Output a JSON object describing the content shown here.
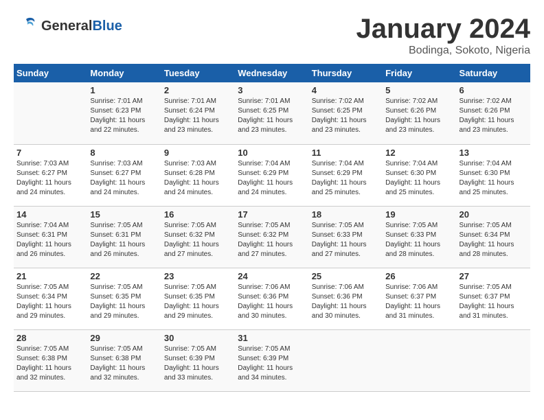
{
  "header": {
    "logo_line1": "General",
    "logo_line2": "Blue",
    "month": "January 2024",
    "location": "Bodinga, Sokoto, Nigeria"
  },
  "days_of_week": [
    "Sunday",
    "Monday",
    "Tuesday",
    "Wednesday",
    "Thursday",
    "Friday",
    "Saturday"
  ],
  "weeks": [
    [
      {
        "day": "",
        "info": ""
      },
      {
        "day": "1",
        "info": "Sunrise: 7:01 AM\nSunset: 6:23 PM\nDaylight: 11 hours\nand 22 minutes."
      },
      {
        "day": "2",
        "info": "Sunrise: 7:01 AM\nSunset: 6:24 PM\nDaylight: 11 hours\nand 23 minutes."
      },
      {
        "day": "3",
        "info": "Sunrise: 7:01 AM\nSunset: 6:25 PM\nDaylight: 11 hours\nand 23 minutes."
      },
      {
        "day": "4",
        "info": "Sunrise: 7:02 AM\nSunset: 6:25 PM\nDaylight: 11 hours\nand 23 minutes."
      },
      {
        "day": "5",
        "info": "Sunrise: 7:02 AM\nSunset: 6:26 PM\nDaylight: 11 hours\nand 23 minutes."
      },
      {
        "day": "6",
        "info": "Sunrise: 7:02 AM\nSunset: 6:26 PM\nDaylight: 11 hours\nand 23 minutes."
      }
    ],
    [
      {
        "day": "7",
        "info": "Sunrise: 7:03 AM\nSunset: 6:27 PM\nDaylight: 11 hours\nand 24 minutes."
      },
      {
        "day": "8",
        "info": "Sunrise: 7:03 AM\nSunset: 6:27 PM\nDaylight: 11 hours\nand 24 minutes."
      },
      {
        "day": "9",
        "info": "Sunrise: 7:03 AM\nSunset: 6:28 PM\nDaylight: 11 hours\nand 24 minutes."
      },
      {
        "day": "10",
        "info": "Sunrise: 7:04 AM\nSunset: 6:29 PM\nDaylight: 11 hours\nand 24 minutes."
      },
      {
        "day": "11",
        "info": "Sunrise: 7:04 AM\nSunset: 6:29 PM\nDaylight: 11 hours\nand 25 minutes."
      },
      {
        "day": "12",
        "info": "Sunrise: 7:04 AM\nSunset: 6:30 PM\nDaylight: 11 hours\nand 25 minutes."
      },
      {
        "day": "13",
        "info": "Sunrise: 7:04 AM\nSunset: 6:30 PM\nDaylight: 11 hours\nand 25 minutes."
      }
    ],
    [
      {
        "day": "14",
        "info": "Sunrise: 7:04 AM\nSunset: 6:31 PM\nDaylight: 11 hours\nand 26 minutes."
      },
      {
        "day": "15",
        "info": "Sunrise: 7:05 AM\nSunset: 6:31 PM\nDaylight: 11 hours\nand 26 minutes."
      },
      {
        "day": "16",
        "info": "Sunrise: 7:05 AM\nSunset: 6:32 PM\nDaylight: 11 hours\nand 27 minutes."
      },
      {
        "day": "17",
        "info": "Sunrise: 7:05 AM\nSunset: 6:32 PM\nDaylight: 11 hours\nand 27 minutes."
      },
      {
        "day": "18",
        "info": "Sunrise: 7:05 AM\nSunset: 6:33 PM\nDaylight: 11 hours\nand 27 minutes."
      },
      {
        "day": "19",
        "info": "Sunrise: 7:05 AM\nSunset: 6:33 PM\nDaylight: 11 hours\nand 28 minutes."
      },
      {
        "day": "20",
        "info": "Sunrise: 7:05 AM\nSunset: 6:34 PM\nDaylight: 11 hours\nand 28 minutes."
      }
    ],
    [
      {
        "day": "21",
        "info": "Sunrise: 7:05 AM\nSunset: 6:34 PM\nDaylight: 11 hours\nand 29 minutes."
      },
      {
        "day": "22",
        "info": "Sunrise: 7:05 AM\nSunset: 6:35 PM\nDaylight: 11 hours\nand 29 minutes."
      },
      {
        "day": "23",
        "info": "Sunrise: 7:05 AM\nSunset: 6:35 PM\nDaylight: 11 hours\nand 29 minutes."
      },
      {
        "day": "24",
        "info": "Sunrise: 7:06 AM\nSunset: 6:36 PM\nDaylight: 11 hours\nand 30 minutes."
      },
      {
        "day": "25",
        "info": "Sunrise: 7:06 AM\nSunset: 6:36 PM\nDaylight: 11 hours\nand 30 minutes."
      },
      {
        "day": "26",
        "info": "Sunrise: 7:06 AM\nSunset: 6:37 PM\nDaylight: 11 hours\nand 31 minutes."
      },
      {
        "day": "27",
        "info": "Sunrise: 7:05 AM\nSunset: 6:37 PM\nDaylight: 11 hours\nand 31 minutes."
      }
    ],
    [
      {
        "day": "28",
        "info": "Sunrise: 7:05 AM\nSunset: 6:38 PM\nDaylight: 11 hours\nand 32 minutes."
      },
      {
        "day": "29",
        "info": "Sunrise: 7:05 AM\nSunset: 6:38 PM\nDaylight: 11 hours\nand 32 minutes."
      },
      {
        "day": "30",
        "info": "Sunrise: 7:05 AM\nSunset: 6:39 PM\nDaylight: 11 hours\nand 33 minutes."
      },
      {
        "day": "31",
        "info": "Sunrise: 7:05 AM\nSunset: 6:39 PM\nDaylight: 11 hours\nand 34 minutes."
      },
      {
        "day": "",
        "info": ""
      },
      {
        "day": "",
        "info": ""
      },
      {
        "day": "",
        "info": ""
      }
    ]
  ]
}
